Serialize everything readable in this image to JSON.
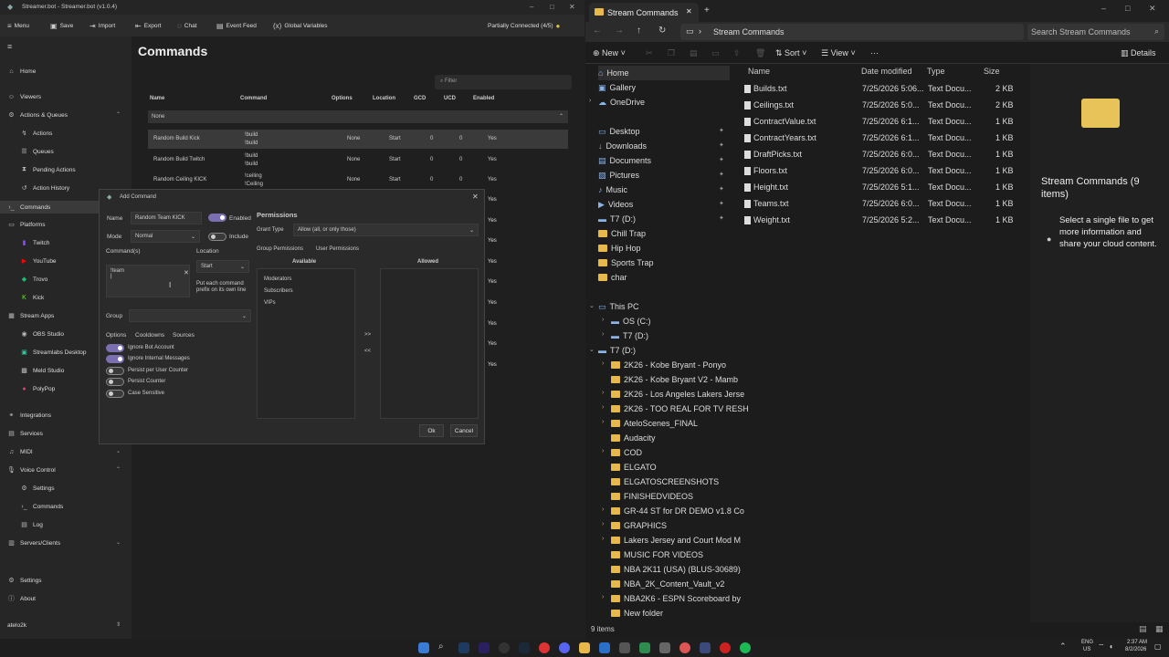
{
  "sb": {
    "title": "Streamer.bot - Streamer.bot (v1.0.4)",
    "menu": [
      {
        "icon": "menu",
        "label": "Menu"
      },
      {
        "icon": "save",
        "label": "Save"
      },
      {
        "icon": "import",
        "label": "Import"
      },
      {
        "icon": "export",
        "label": "Export"
      },
      {
        "icon": "chat",
        "label": "Chat"
      },
      {
        "icon": "event",
        "label": "Event Feed"
      },
      {
        "icon": "vars",
        "label": "Global Variables"
      }
    ],
    "status": "Partially Connected (4/5)",
    "side": [
      {
        "label": "Home"
      },
      {
        "label": "Viewers"
      },
      {
        "label": "Actions & Queues"
      },
      {
        "label": "Actions"
      },
      {
        "label": "Queues"
      },
      {
        "label": "Pending Actions"
      },
      {
        "label": "Action History"
      },
      {
        "label": "Commands"
      },
      {
        "label": "Platforms"
      },
      {
        "label": "Twitch"
      },
      {
        "label": "YouTube"
      },
      {
        "label": "Trovo"
      },
      {
        "label": "Kick"
      },
      {
        "label": "Stream Apps"
      },
      {
        "label": "OBS Studio"
      },
      {
        "label": "Streamlabs Desktop"
      },
      {
        "label": "Meld Studio"
      },
      {
        "label": "PolyPop"
      },
      {
        "label": "Integrations"
      },
      {
        "label": "Services"
      },
      {
        "label": "MIDI"
      },
      {
        "label": "Voice Control"
      },
      {
        "label": "Settings"
      },
      {
        "label": "Commands"
      },
      {
        "label": "Log"
      },
      {
        "label": "Servers/Clients"
      },
      {
        "label": "Settings"
      },
      {
        "label": "About"
      },
      {
        "label": "atelo2k"
      }
    ],
    "page_title": "Commands",
    "filter_placeholder": "Filter",
    "cols": [
      "Name",
      "Command",
      "Options",
      "Location",
      "GCD",
      "UCD",
      "Enabled"
    ],
    "group": "None",
    "rows": [
      {
        "name": "Random Build Kick",
        "cmd1": "!build",
        "cmd2": "!build",
        "opt": "None",
        "loc": "Start",
        "gcd": "0",
        "ucd": "0",
        "en": "Yes"
      },
      {
        "name": "Random Build Twitch",
        "cmd1": "!build",
        "cmd2": "!build",
        "opt": "None",
        "loc": "Start",
        "gcd": "0",
        "ucd": "0",
        "en": "Yes"
      },
      {
        "name": "Random Ceiling KICK",
        "cmd1": "!ceiling",
        "cmd2": "!Ceiling",
        "opt": "None",
        "loc": "Start",
        "gcd": "0",
        "ucd": "0",
        "en": "Yes"
      }
    ],
    "yes": "Yes"
  },
  "dlg": {
    "title": "Add Command",
    "name_label": "Name",
    "name_value": "Random Team KICK",
    "enabled": "Enabled",
    "mode_label": "Mode",
    "mode_value": "Normal",
    "include": "Include",
    "commands_label": "Command(s)",
    "command_text": "!team",
    "location_label": "Location",
    "location_value": "Start",
    "prefix_note": "Put each command prefix on its own line",
    "group_label": "Group",
    "tabs": [
      "Options",
      "Cooldowns",
      "Sources"
    ],
    "options": [
      {
        "label": "Ignore Bot Account",
        "on": true
      },
      {
        "label": "Ignore Internal Messages",
        "on": true
      },
      {
        "label": "Persist per User Counter",
        "on": false
      },
      {
        "label": "Persist Counter",
        "on": false
      },
      {
        "label": "Case Sensitive",
        "on": false
      }
    ],
    "perm_title": "Permissions",
    "grant_label": "Grant Type",
    "grant_value": "Allow (all, or only those)",
    "perm_tabs": [
      "Group Permissions",
      "User Permissions"
    ],
    "available": "Available",
    "allowed": "Allowed",
    "avail_items": [
      "Moderators",
      "Subscribers",
      "VIPs"
    ],
    "right": ">>",
    "left": "<<",
    "ok": "Ok",
    "cancel": "Cancel"
  },
  "ex": {
    "tab": "Stream Commands",
    "path": "Stream Commands",
    "search": "Search Stream Commands",
    "new": "New",
    "sort": "Sort",
    "view": "View",
    "details": "Details",
    "nav": [
      "Home",
      "Gallery",
      "OneDrive",
      "Desktop",
      "Downloads",
      "Documents",
      "Pictures",
      "Music",
      "Videos",
      "T7 (D:)",
      "Chill Trap",
      "Hip Hop",
      "Sports Trap",
      "char",
      "This PC",
      "OS (C:)",
      "T7 (D:)",
      "T7 (D:)",
      "2K26 - Kobe Bryant - Ponyo",
      "2K26 - Kobe Bryant V2 - Mamb",
      "2K26 - Los Angeles Lakers Jerse",
      "2K26 - TOO REAL FOR TV RESH",
      "AteloScenes_FINAL",
      "Audacity",
      "COD",
      "ELGATO",
      "ELGATOSCREENSHOTS",
      "FINISHEDVIDEOS",
      "GR-44 ST for DR DEMO v1.8 Co",
      "GRAPHICS",
      "Lakers Jersey and Court Mod M",
      "MUSIC FOR VIDEOS",
      "NBA 2K11 (USA) (BLUS-30689)",
      "NBA_2K_Content_Vault_v2",
      "NBA2K6 - ESPN Scoreboard by",
      "New folder"
    ],
    "cols": [
      "Name",
      "Date modified",
      "Type",
      "Size"
    ],
    "files": [
      {
        "name": "Builds.txt",
        "date": "7/25/2026 5:06...",
        "type": "Text Docu...",
        "size": "2 KB"
      },
      {
        "name": "Ceilings.txt",
        "date": "7/25/2026 5:0...",
        "type": "Text Docu...",
        "size": "2 KB"
      },
      {
        "name": "ContractValue.txt",
        "date": "7/25/2026 6:1...",
        "type": "Text Docu...",
        "size": "1 KB"
      },
      {
        "name": "ContractYears.txt",
        "date": "7/25/2026 6:1...",
        "type": "Text Docu...",
        "size": "1 KB"
      },
      {
        "name": "DraftPicks.txt",
        "date": "7/25/2026 6:0...",
        "type": "Text Docu...",
        "size": "1 KB"
      },
      {
        "name": "Floors.txt",
        "date": "7/25/2026 6:0...",
        "type": "Text Docu...",
        "size": "1 KB"
      },
      {
        "name": "Height.txt",
        "date": "7/25/2026 5:1...",
        "type": "Text Docu...",
        "size": "1 KB"
      },
      {
        "name": "Teams.txt",
        "date": "7/25/2026 6:0...",
        "type": "Text Docu...",
        "size": "1 KB"
      },
      {
        "name": "Weight.txt",
        "date": "7/25/2026 5:2...",
        "type": "Text Docu...",
        "size": "1 KB"
      }
    ],
    "detail_title": "Stream Commands (9 items)",
    "detail_msg": "Select a single file to get more information and share your cloud content.",
    "items": "9 items"
  },
  "taskbar": {
    "lang1": "ENG",
    "lang2": "US",
    "time": "2:37 AM",
    "date": "8/2/2026"
  }
}
